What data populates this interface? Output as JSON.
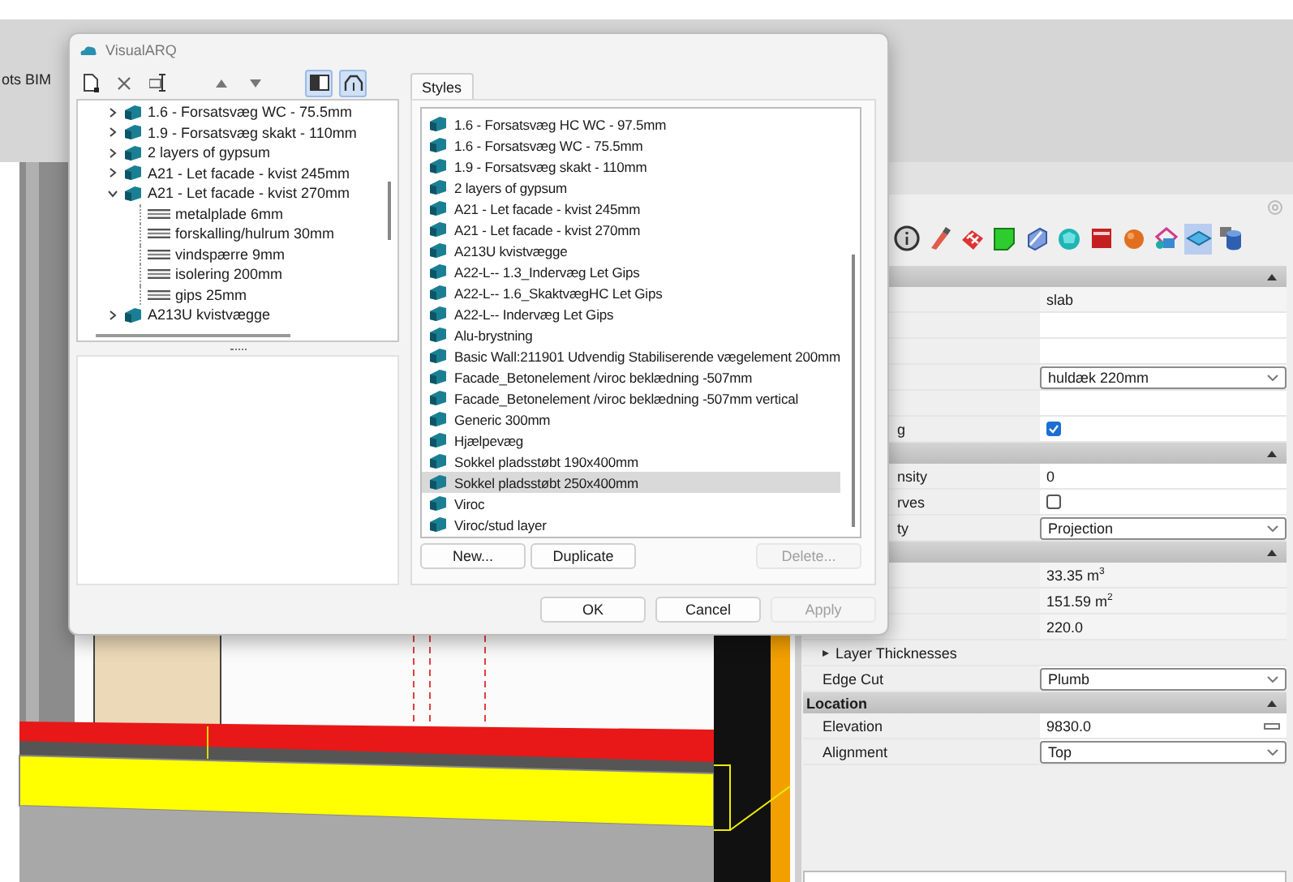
{
  "background_tab": "ots BIM",
  "dialog": {
    "title": "VisualARQ",
    "toolbar_actions": [
      {
        "kind": "new"
      },
      {
        "kind": "delete"
      },
      {
        "kind": "rename"
      },
      {
        "kind": "up"
      },
      {
        "kind": "down"
      }
    ],
    "view_toggles": [
      {
        "kind": "list",
        "selected": true
      },
      {
        "kind": "tree",
        "selected": true
      }
    ],
    "tree": [
      {
        "label": "1.6 - Forsatsvæg WC - 75.5mm",
        "expanded": false
      },
      {
        "label": "1.9 - Forsatsvæg skakt - 110mm",
        "expanded": false
      },
      {
        "label": "2 layers of gypsum",
        "expanded": false
      },
      {
        "label": "A21 - Let facade - kvist 245mm",
        "expanded": false
      },
      {
        "label": "A21 - Let facade - kvist 270mm",
        "expanded": true,
        "children": [
          {
            "label": "metalplade 6mm"
          },
          {
            "label": "forskalling/hulrum 30mm"
          },
          {
            "label": "vindspærre 9mm"
          },
          {
            "label": "isolering 200mm"
          },
          {
            "label": "gips 25mm"
          }
        ]
      },
      {
        "label": "A213U kvistvægge",
        "expanded": false
      }
    ],
    "tabs": [
      {
        "label": "Styles",
        "selected": true
      }
    ],
    "styles": [
      {
        "label": "1.6 - Forsatsvæg HC WC - 97.5mm",
        "selected": false
      },
      {
        "label": "1.6 - Forsatsvæg WC - 75.5mm",
        "selected": false
      },
      {
        "label": "1.9 - Forsatsvæg skakt - 110mm",
        "selected": false
      },
      {
        "label": "2 layers of gypsum",
        "selected": false
      },
      {
        "label": "A21 - Let facade - kvist 245mm",
        "selected": false
      },
      {
        "label": "A21 - Let facade - kvist 270mm",
        "selected": false
      },
      {
        "label": "A213U kvistvægge",
        "selected": false
      },
      {
        "label": "A22-L-- 1.3_Indervæg Let Gips",
        "selected": false
      },
      {
        "label": "A22-L-- 1.6_SkaktvægHC Let Gips",
        "selected": false
      },
      {
        "label": "A22-L-- Indervæg Let Gips",
        "selected": false
      },
      {
        "label": "Alu-brystning",
        "selected": false
      },
      {
        "label": "Basic Wall:211901 Udvendig Stabiliserende vægelement 200mm",
        "selected": false
      },
      {
        "label": "Facade_Betonelement /viroc beklædning -507mm",
        "selected": false
      },
      {
        "label": "Facade_Betonelement /viroc beklædning -507mm vertical",
        "selected": false
      },
      {
        "label": "Generic 300mm",
        "selected": false
      },
      {
        "label": "Hjælpevæg",
        "selected": false
      },
      {
        "label": "Sokkel pladsstøbt 190x400mm",
        "selected": false
      },
      {
        "label": "Sokkel pladsstøbt 250x400mm",
        "selected": true
      },
      {
        "label": "Viroc",
        "selected": false
      },
      {
        "label": "Viroc/stud layer",
        "selected": false
      }
    ],
    "style_buttons": [
      {
        "label": "New...",
        "disabled": false
      },
      {
        "label": "Duplicate",
        "disabled": false
      },
      {
        "label": "Delete...",
        "disabled": true
      }
    ],
    "footer_buttons": [
      {
        "label": "OK",
        "disabled": false
      },
      {
        "label": "Cancel",
        "disabled": false
      },
      {
        "label": "Apply",
        "disabled": true
      }
    ]
  },
  "panel": {
    "tools": [
      {
        "kind": "info",
        "selected": false
      },
      {
        "kind": "brush",
        "selected": false
      },
      {
        "kind": "grid",
        "selected": false
      },
      {
        "kind": "surface",
        "selected": false
      },
      {
        "kind": "solid",
        "selected": false
      },
      {
        "kind": "sphere",
        "selected": false
      },
      {
        "kind": "box",
        "selected": false
      },
      {
        "kind": "ball",
        "selected": false
      },
      {
        "kind": "multi",
        "selected": false
      },
      {
        "kind": "slab",
        "selected": true
      },
      {
        "kind": "cylinder",
        "selected": false
      }
    ],
    "sections": [
      {
        "rows": [
          {
            "kind": "readonly",
            "value": "slab"
          },
          {
            "kind": "text"
          },
          {
            "kind": "text"
          },
          {
            "kind": "dropdown",
            "value": "huldæk 220mm"
          },
          {
            "kind": "text"
          },
          {
            "kind": "checkbox",
            "label_cut": "g",
            "checked": true
          }
        ]
      },
      {
        "rows": [
          {
            "kind": "text",
            "label_cut": "nsity",
            "value": "0"
          },
          {
            "kind": "checkbox",
            "label_cut": "rves",
            "checked": false
          },
          {
            "kind": "dropdown",
            "label_cut": "ty",
            "value": "Projection"
          }
        ]
      },
      {
        "rows": [
          {
            "kind": "readonly",
            "value": "33.35 m$^{3}$"
          },
          {
            "kind": "readonly",
            "value": "151.59 m$^{2}$"
          },
          {
            "kind": "readonly",
            "value": "220.0"
          },
          {
            "kind": "expander",
            "label": "Layer Thicknesses",
            "expanded": false
          },
          {
            "kind": "dropdown",
            "label": "Edge Cut",
            "value": "Plumb"
          }
        ]
      },
      {
        "title": "Location",
        "rows": [
          {
            "kind": "measure",
            "label": "Elevation",
            "value": "9830.0"
          },
          {
            "kind": "dropdown",
            "label": "Alignment",
            "value": "Top"
          }
        ]
      }
    ]
  }
}
